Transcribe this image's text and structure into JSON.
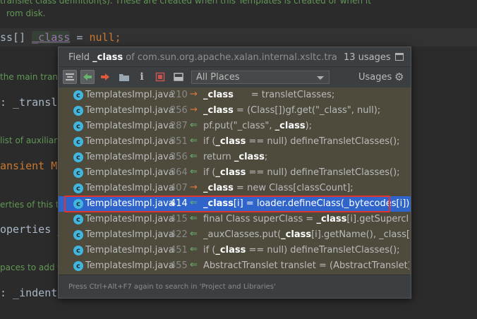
{
  "editor": {
    "lines": [
      {
        "kind": "doc",
        "text": "translet class definition(s). These are created when this Templates is created or when it"
      },
      {
        "kind": "doc",
        "text": "rom disk."
      },
      {
        "kind": "code",
        "text": "ss[] _class = null;"
      },
      {
        "kind": "doc",
        "text": "the main transl"
      },
      {
        "kind": "code",
        "text": ": _transle"
      },
      {
        "kind": "doc",
        "text": "list of auxiliary"
      },
      {
        "kind": "code",
        "text": "ansient Ma"
      },
      {
        "kind": "doc",
        "text": "erties of this tr"
      },
      {
        "kind": "code",
        "text": "operties _"
      },
      {
        "kind": "doc",
        "text": "paces to add f"
      },
      {
        "kind": "code",
        "text": ": _indentN"
      }
    ]
  },
  "popup": {
    "title_prefix": "Field",
    "field_name": "_class",
    "title_of": "of com.sun.org.apache.xalan.internal.xsltc.trax.Templat",
    "usages_count": "13 usages",
    "scope": "All Places",
    "usages_label": "Usages",
    "footer": "Press Ctrl+Alt+F7 again to search in 'Project and Libraries'",
    "rows": [
      {
        "file": "TemplatesImpl.java",
        "line": "210",
        "access": "write",
        "pre": "",
        "bold": "_class",
        "post": "      = transletClasses;"
      },
      {
        "file": "TemplatesImpl.java",
        "line": "256",
        "access": "write",
        "pre": "",
        "bold": "_class",
        "post": " = (Class[])gf.get(\"_class\", null);"
      },
      {
        "file": "TemplatesImpl.java",
        "line": "287",
        "access": "read",
        "pre": "pf.put(\"_class\", ",
        "bold": "_class",
        "post": ");"
      },
      {
        "file": "TemplatesImpl.java",
        "line": "351",
        "access": "read",
        "pre": "if (",
        "bold": "_class",
        "post": " == null) defineTransletClasses();"
      },
      {
        "file": "TemplatesImpl.java",
        "line": "356",
        "access": "read",
        "pre": "return ",
        "bold": "_class",
        "post": ";"
      },
      {
        "file": "TemplatesImpl.java",
        "line": "364",
        "access": "read",
        "pre": "if (",
        "bold": "_class",
        "post": " == null) defineTransletClasses();"
      },
      {
        "file": "TemplatesImpl.java",
        "line": "407",
        "access": "write",
        "pre": "",
        "bold": "_class",
        "post": " = new Class[classCount];"
      },
      {
        "file": "TemplatesImpl.java",
        "line": "414",
        "access": "read",
        "pre": "",
        "bold": "_class",
        "post": "[i] = loader.defineClass(_bytecodes[i]);",
        "selected": true
      },
      {
        "file": "TemplatesImpl.java",
        "line": "415",
        "access": "read",
        "pre": "final Class superClass = ",
        "bold": "_class",
        "post": "[i].getSuperclass();"
      },
      {
        "file": "TemplatesImpl.java",
        "line": "422",
        "access": "read",
        "pre": "_auxClasses.put(",
        "bold": "_class",
        "post": "[i].getName(), _class[i]);"
      },
      {
        "file": "TemplatesImpl.java",
        "line": "451",
        "access": "read",
        "pre": "if (",
        "bold": "_class",
        "post": " == null) defineTransletClasses();"
      },
      {
        "file": "TemplatesImpl.java",
        "line": "455",
        "access": "read",
        "pre": "AbstractTranslet translet = (AbstractTranslet) ",
        "bold": "_class",
        "post": ""
      }
    ]
  },
  "colors": {
    "editor_bg": "#2b2b2b",
    "popup_bg": "#3c3f41",
    "list_bg": "#4e4b3d",
    "selection": "#2f65ca",
    "highlight_border": "#e4332b",
    "write_access": "#e07a3a",
    "read_access": "#6ab36e"
  },
  "icons": {
    "write": "→",
    "read": "⇐"
  }
}
